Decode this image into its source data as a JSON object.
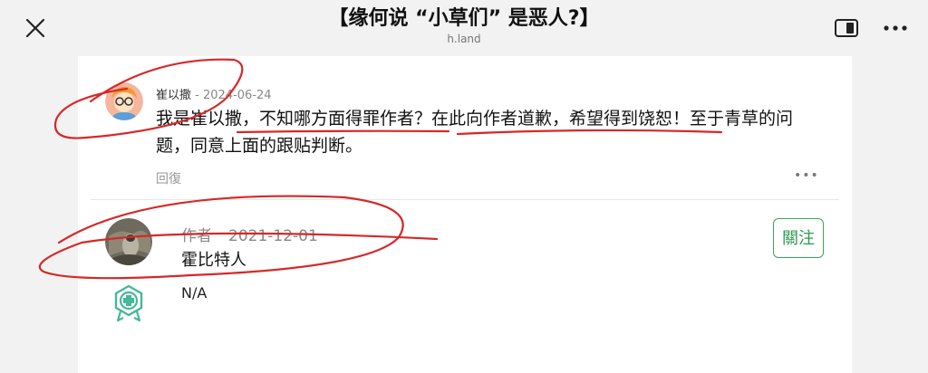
{
  "header": {
    "title": "【缘何说 “小草们” 是恶人?】",
    "subtitle": "h.land",
    "close_icon": "close-icon",
    "reader_icon": "reader-mode-icon",
    "more_icon": "more-horizontal-icon"
  },
  "comment": {
    "author": "崔以撒",
    "date": "- 2024-06-24",
    "text": "我是崔以撒，不知哪方面得罪作者？在此向作者道歉，希望得到饶恕！至于青草的问题，同意上面的跟贴判断。",
    "reply_label": "回復",
    "more_label": "•••"
  },
  "author_card": {
    "role": "作者",
    "date": "2021-12-01",
    "name": "霍比特人",
    "follow_label": "關注",
    "bio": "N/A",
    "badge_icon": "badge-cross-icon"
  },
  "colors": {
    "accent_green": "#3aa35a",
    "annotation_red": "#d62828"
  }
}
